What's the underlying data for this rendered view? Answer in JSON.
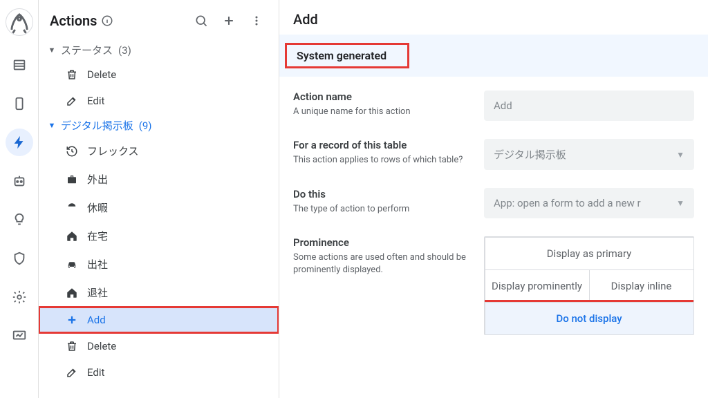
{
  "rail": {
    "items": [
      "rocket",
      "table",
      "phone",
      "bolt",
      "bot",
      "bulb",
      "shield",
      "gear",
      "monitor"
    ]
  },
  "sidebar": {
    "title": "Actions",
    "groups": [
      {
        "label": "ステータス",
        "count": "(3)",
        "expanded": true,
        "blue": false,
        "items": [
          {
            "icon": "trash",
            "label": "Delete"
          },
          {
            "icon": "edit",
            "label": "Edit"
          }
        ]
      },
      {
        "label": "デジタル掲示板",
        "count": "(9)",
        "expanded": true,
        "blue": true,
        "items": [
          {
            "icon": "history",
            "label": "フレックス"
          },
          {
            "icon": "briefcase",
            "label": "外出"
          },
          {
            "icon": "beach",
            "label": "休暇"
          },
          {
            "icon": "home",
            "label": "在宅"
          },
          {
            "icon": "car",
            "label": "出社"
          },
          {
            "icon": "home",
            "label": "退社"
          },
          {
            "icon": "plus",
            "label": "Add",
            "selected": true,
            "redbox": true
          },
          {
            "icon": "trash",
            "label": "Delete"
          },
          {
            "icon": "edit",
            "label": "Edit"
          }
        ]
      }
    ]
  },
  "main": {
    "title": "Add",
    "system_label": "System generated",
    "fields": {
      "action_name": {
        "title": "Action name",
        "desc": "A unique name for this action",
        "value": "Add"
      },
      "table": {
        "title": "For a record of this table",
        "desc": "This action applies to rows of which table?",
        "value": "デジタル掲示板"
      },
      "do_this": {
        "title": "Do this",
        "desc": "The type of action to perform",
        "value": "App: open a form to add a new r"
      },
      "prominence": {
        "title": "Prominence",
        "desc": "Some actions are used often and should be prominently displayed.",
        "options": [
          "Display as primary",
          "Display prominently",
          "Display inline",
          "Do not display"
        ],
        "selected": 3
      }
    }
  }
}
